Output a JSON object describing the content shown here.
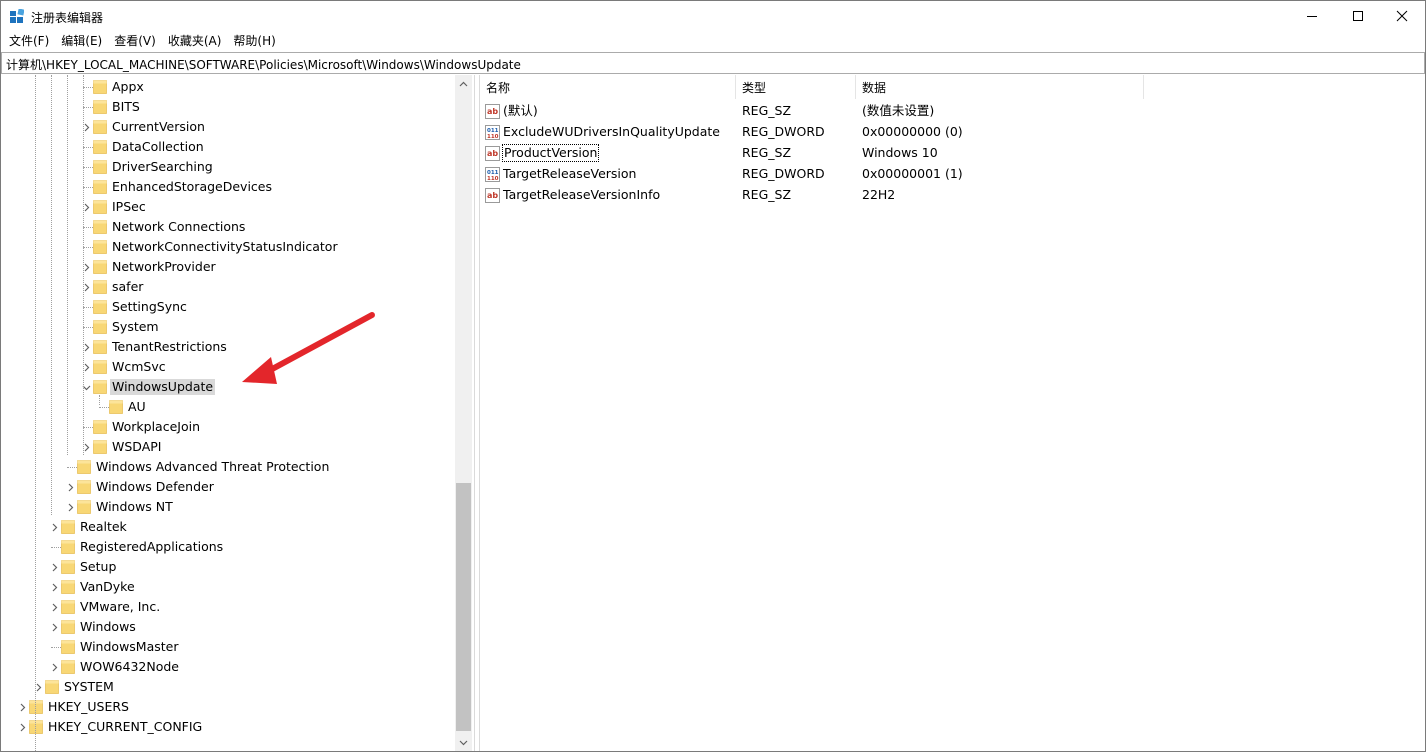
{
  "window": {
    "title": "注册表编辑器"
  },
  "menubar": [
    "文件(F)",
    "编辑(E)",
    "查看(V)",
    "收藏夹(A)",
    "帮助(H)"
  ],
  "address": "计算机\\HKEY_LOCAL_MACHINE\\SOFTWARE\\Policies\\Microsoft\\Windows\\WindowsUpdate",
  "tree": [
    {
      "label": "Appx",
      "level": 5,
      "expander": "none"
    },
    {
      "label": "BITS",
      "level": 5,
      "expander": "none"
    },
    {
      "label": "CurrentVersion",
      "level": 5,
      "expander": "collapsed"
    },
    {
      "label": "DataCollection",
      "level": 5,
      "expander": "none"
    },
    {
      "label": "DriverSearching",
      "level": 5,
      "expander": "none"
    },
    {
      "label": "EnhancedStorageDevices",
      "level": 5,
      "expander": "none"
    },
    {
      "label": "IPSec",
      "level": 5,
      "expander": "collapsed"
    },
    {
      "label": "Network Connections",
      "level": 5,
      "expander": "none"
    },
    {
      "label": "NetworkConnectivityStatusIndicator",
      "level": 5,
      "expander": "none"
    },
    {
      "label": "NetworkProvider",
      "level": 5,
      "expander": "collapsed"
    },
    {
      "label": "safer",
      "level": 5,
      "expander": "collapsed"
    },
    {
      "label": "SettingSync",
      "level": 5,
      "expander": "none"
    },
    {
      "label": "System",
      "level": 5,
      "expander": "none"
    },
    {
      "label": "TenantRestrictions",
      "level": 5,
      "expander": "collapsed"
    },
    {
      "label": "WcmSvc",
      "level": 5,
      "expander": "collapsed"
    },
    {
      "label": "WindowsUpdate",
      "level": 5,
      "expander": "expanded",
      "selected": true
    },
    {
      "label": "AU",
      "level": 6,
      "expander": "none"
    },
    {
      "label": "WorkplaceJoin",
      "level": 5,
      "expander": "none"
    },
    {
      "label": "WSDAPI",
      "level": 5,
      "expander": "collapsed"
    },
    {
      "label": "Windows Advanced Threat Protection",
      "level": 4,
      "expander": "none"
    },
    {
      "label": "Windows Defender",
      "level": 4,
      "expander": "collapsed"
    },
    {
      "label": "Windows NT",
      "level": 4,
      "expander": "collapsed"
    },
    {
      "label": "Realtek",
      "level": 3,
      "expander": "collapsed"
    },
    {
      "label": "RegisteredApplications",
      "level": 3,
      "expander": "none"
    },
    {
      "label": "Setup",
      "level": 3,
      "expander": "collapsed"
    },
    {
      "label": "VanDyke",
      "level": 3,
      "expander": "collapsed"
    },
    {
      "label": "VMware, Inc.",
      "level": 3,
      "expander": "collapsed"
    },
    {
      "label": "Windows",
      "level": 3,
      "expander": "collapsed"
    },
    {
      "label": "WindowsMaster",
      "level": 3,
      "expander": "none"
    },
    {
      "label": "WOW6432Node",
      "level": 3,
      "expander": "collapsed"
    },
    {
      "label": "SYSTEM",
      "level": 2,
      "expander": "collapsed"
    },
    {
      "label": "HKEY_USERS",
      "level": 1,
      "expander": "collapsed"
    },
    {
      "label": "HKEY_CURRENT_CONFIG",
      "level": 1,
      "expander": "collapsed"
    }
  ],
  "columns": {
    "name": "名称",
    "type": "类型",
    "data": "数据"
  },
  "values": [
    {
      "name": "(默认)",
      "type": "REG_SZ",
      "data": "(数值未设置)",
      "icon": "string-value-icon"
    },
    {
      "name": "ExcludeWUDriversInQualityUpdate",
      "type": "REG_DWORD",
      "data": "0x00000000 (0)",
      "icon": "binary-value-icon"
    },
    {
      "name": "ProductVersion",
      "type": "REG_SZ",
      "data": "Windows 10",
      "icon": "string-value-icon",
      "focused": true
    },
    {
      "name": "TargetReleaseVersion",
      "type": "REG_DWORD",
      "data": "0x00000001 (1)",
      "icon": "binary-value-icon"
    },
    {
      "name": "TargetReleaseVersionInfo",
      "type": "REG_SZ",
      "data": "22H2",
      "icon": "string-value-icon"
    }
  ],
  "colors": {
    "folder": "#f8d775",
    "folder_edge": "#e2b33c",
    "selection": "#d9d9d9",
    "annotation_arrow": "#e3262b",
    "icon_red": "#c0392b",
    "icon_blue": "#1f5fae"
  }
}
